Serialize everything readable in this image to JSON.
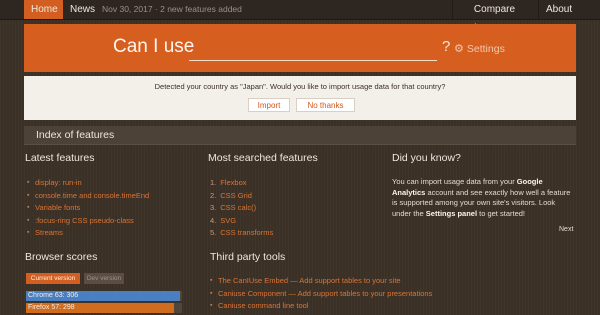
{
  "nav": {
    "home": "Home",
    "news": "News",
    "news_date": "Nov 30, 2017 · 2 new features added",
    "compare": "Compare browsers",
    "about": "About"
  },
  "search": {
    "label": "Can I use",
    "value": "",
    "help": "?",
    "settings": "Settings"
  },
  "country_notice": {
    "text": "Detected your country as \"Japan\". Would you like to import usage data for that country?",
    "import": "Import",
    "no_thanks": "No thanks"
  },
  "index": {
    "title": "Index of features"
  },
  "latest": {
    "title": "Latest features",
    "items": [
      "display: run-in",
      "console.time and console.timeEnd",
      "Variable fonts",
      ":focus-ring CSS pseudo-class",
      "Streams"
    ]
  },
  "most_searched": {
    "title": "Most searched features",
    "items": [
      {
        "n": "1.",
        "label": "Flexbox"
      },
      {
        "n": "2.",
        "label": "CSS Grid"
      },
      {
        "n": "3.",
        "label": "CSS calc()"
      },
      {
        "n": "4.",
        "label": "SVG"
      },
      {
        "n": "5.",
        "label": "CSS transforms"
      }
    ]
  },
  "did_you_know": {
    "title": "Did you know?",
    "text_1": "You can import usage data from your ",
    "bold_1": "Google Analytics",
    "text_2": " account and see exactly how well a feature is supported among your own site's visitors. Look under the ",
    "bold_2": "Settings panel",
    "text_3": " to get started!",
    "next": "Next"
  },
  "browser_scores": {
    "title": "Browser scores",
    "tab_current": "Current version",
    "tab_dev": "Dev version",
    "scores": [
      {
        "label": "Chrome 63: 306",
        "fraction": 0.99,
        "color": "#4a7fc1"
      },
      {
        "label": "Firefox 57: 298",
        "fraction": 0.95,
        "color": "#cf6c1d"
      }
    ]
  },
  "third_party": {
    "title": "Third party tools",
    "items": [
      "The CanIUse Embed — Add support tables to your site",
      "Caniuse Component — Add support tables to your presentations",
      "Caniuse command line tool"
    ]
  },
  "colors": {
    "accent": "#d65f20",
    "background": "#3b3026",
    "link": "#db7434"
  }
}
